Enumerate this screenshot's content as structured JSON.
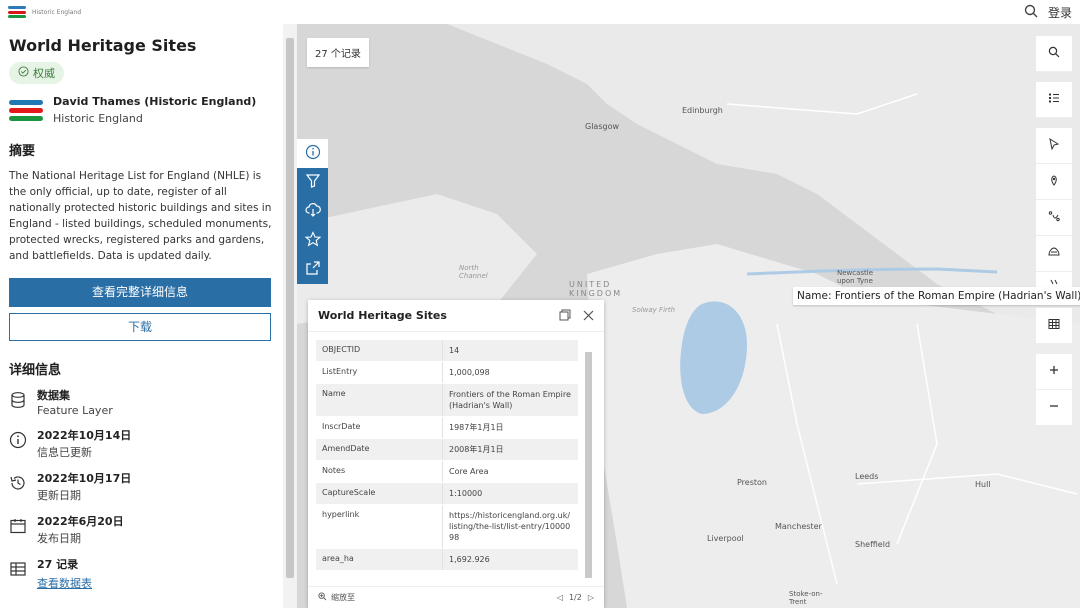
{
  "topbar": {
    "brand": "Historic England",
    "login": "登录"
  },
  "sidebar": {
    "title": "World Heritage Sites",
    "badge": "权威",
    "owner_name": "David Thames (Historic England)",
    "owner_org": "Historic England",
    "summary_heading": "摘要",
    "summary": "The National Heritage List for England (NHLE) is the only official, up to date, register of all nationally protected historic buildings and sites in England - listed buildings, scheduled monuments, protected wrecks, registered parks and gardens, and battlefields. Data is updated daily.",
    "btn_details": "查看完整详细信息",
    "btn_download": "下载",
    "details_heading": "详细信息",
    "details": [
      {
        "t1": "数据集",
        "t2": "Feature Layer",
        "icon": "database-icon"
      },
      {
        "t1": "2022年10月14日",
        "t2": "信息已更新",
        "icon": "info-icon"
      },
      {
        "t1": "2022年10月17日",
        "t2": "更新日期",
        "icon": "history-icon"
      },
      {
        "t1": "2022年6月20日",
        "t2": "发布日期",
        "icon": "calendar-icon"
      },
      {
        "t1": "27 记录",
        "t2": "查看数据表",
        "icon": "table-icon"
      }
    ]
  },
  "map": {
    "record_count": "27 个记录",
    "tooltip": "Name: Frontiers of the Roman Empire (Hadrian's Wall)",
    "labels": {
      "glasgow": "Glasgow",
      "edinburgh": "Edinburgh",
      "north_channel": "North Channel",
      "uk": "UNITED KINGDOM",
      "solway": "Solway Firth",
      "newcastle": "Newcastle upon Tyne",
      "preston": "Preston",
      "leeds": "Leeds",
      "hull": "Hull",
      "manchester": "Manchester",
      "liverpool": "Liverpool",
      "sheffield": "Sheffield",
      "stoke": "Stoke-on-Trent"
    }
  },
  "popup": {
    "title": "World Heritage Sites",
    "rows": [
      {
        "k": "OBJECTID",
        "v": "14"
      },
      {
        "k": "ListEntry",
        "v": "1,000,098"
      },
      {
        "k": "Name",
        "v": "Frontiers of the Roman Empire (Hadrian's Wall)"
      },
      {
        "k": "InscrDate",
        "v": "1987年1月1日"
      },
      {
        "k": "AmendDate",
        "v": "2008年1月1日"
      },
      {
        "k": "Notes",
        "v": "Core Area"
      },
      {
        "k": "CaptureScale",
        "v": "1:10000"
      },
      {
        "k": "hyperlink",
        "v": "https://historicengland.org.uk/listing/the-list/list-entry/1000098"
      },
      {
        "k": "area_ha",
        "v": "1,692.926"
      }
    ],
    "zoom_to": "缩放至",
    "pager": "1/2"
  },
  "colors": {
    "accent": "#2a6ea6",
    "water": "#aecbe6",
    "land": "#e6e6e6"
  }
}
